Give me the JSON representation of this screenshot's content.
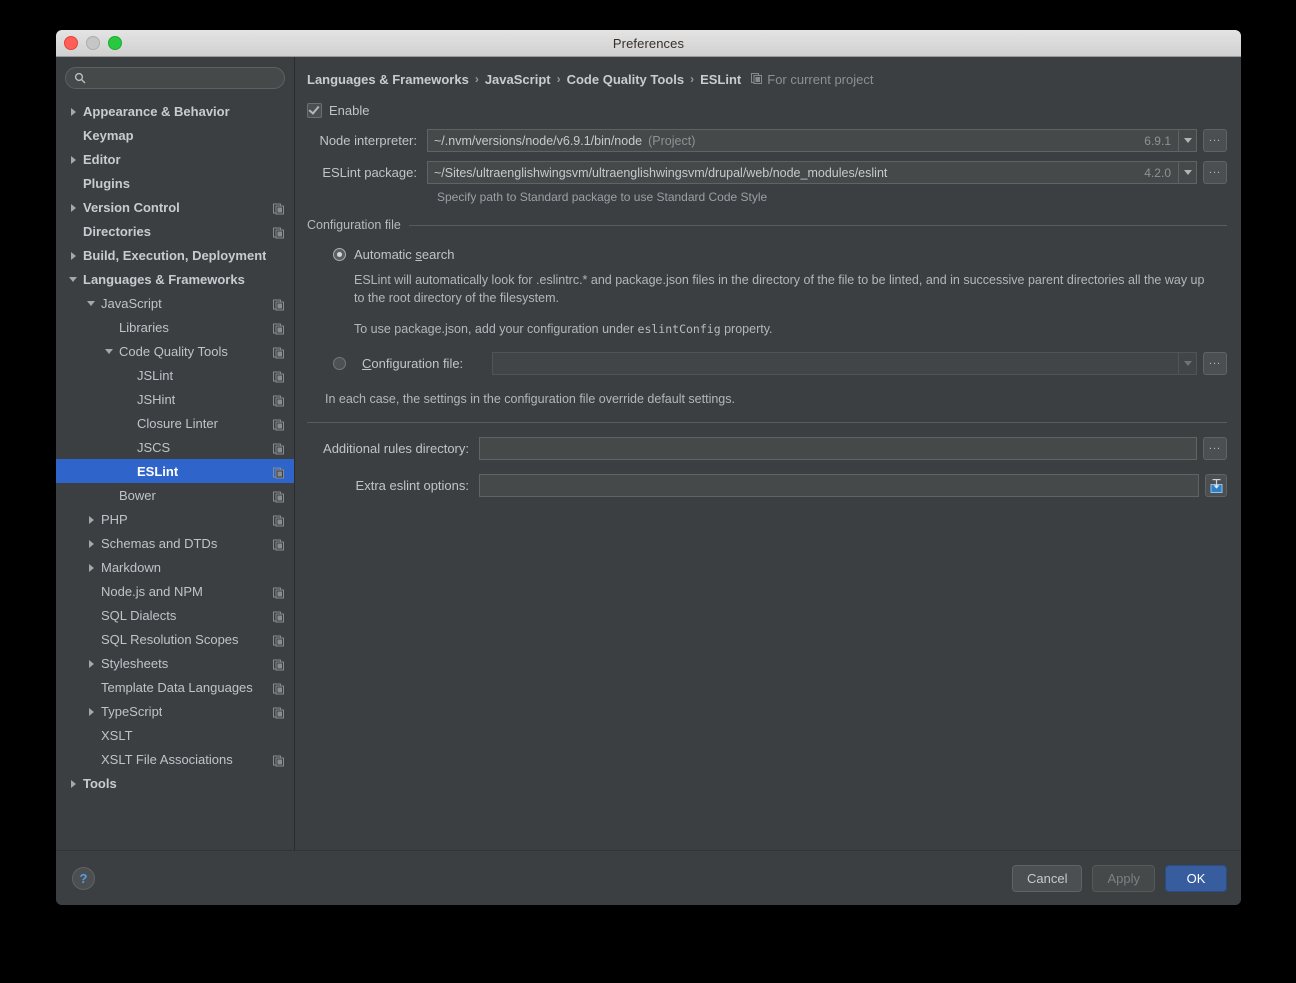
{
  "window": {
    "title": "Preferences",
    "traffic": [
      "close-button",
      "minimize-button",
      "maximize-button"
    ]
  },
  "sidebar": {
    "search": {
      "value": "",
      "placeholder": ""
    },
    "items": [
      {
        "label": "Appearance & Behavior",
        "indent": 0,
        "arrow": "right",
        "bold": true,
        "project_icon": false,
        "selected": false
      },
      {
        "label": "Keymap",
        "indent": 0,
        "arrow": "none",
        "bold": true,
        "project_icon": false,
        "selected": false
      },
      {
        "label": "Editor",
        "indent": 0,
        "arrow": "right",
        "bold": true,
        "project_icon": false,
        "selected": false
      },
      {
        "label": "Plugins",
        "indent": 0,
        "arrow": "none",
        "bold": true,
        "project_icon": false,
        "selected": false
      },
      {
        "label": "Version Control",
        "indent": 0,
        "arrow": "right",
        "bold": true,
        "project_icon": true,
        "selected": false
      },
      {
        "label": "Directories",
        "indent": 0,
        "arrow": "none",
        "bold": true,
        "project_icon": true,
        "selected": false
      },
      {
        "label": "Build, Execution, Deployment",
        "indent": 0,
        "arrow": "right",
        "bold": true,
        "project_icon": false,
        "selected": false
      },
      {
        "label": "Languages & Frameworks",
        "indent": 0,
        "arrow": "down",
        "bold": true,
        "project_icon": false,
        "selected": false
      },
      {
        "label": "JavaScript",
        "indent": 1,
        "arrow": "down",
        "bold": false,
        "project_icon": true,
        "selected": false
      },
      {
        "label": "Libraries",
        "indent": 2,
        "arrow": "none",
        "bold": false,
        "project_icon": true,
        "selected": false
      },
      {
        "label": "Code Quality Tools",
        "indent": 2,
        "arrow": "down",
        "bold": false,
        "project_icon": true,
        "selected": false
      },
      {
        "label": "JSLint",
        "indent": 3,
        "arrow": "none",
        "bold": false,
        "project_icon": true,
        "selected": false
      },
      {
        "label": "JSHint",
        "indent": 3,
        "arrow": "none",
        "bold": false,
        "project_icon": true,
        "selected": false
      },
      {
        "label": "Closure Linter",
        "indent": 3,
        "arrow": "none",
        "bold": false,
        "project_icon": true,
        "selected": false
      },
      {
        "label": "JSCS",
        "indent": 3,
        "arrow": "none",
        "bold": false,
        "project_icon": true,
        "selected": false
      },
      {
        "label": "ESLint",
        "indent": 3,
        "arrow": "none",
        "bold": false,
        "project_icon": true,
        "selected": true
      },
      {
        "label": "Bower",
        "indent": 2,
        "arrow": "none",
        "bold": false,
        "project_icon": true,
        "selected": false
      },
      {
        "label": "PHP",
        "indent": 1,
        "arrow": "right",
        "bold": false,
        "project_icon": true,
        "selected": false
      },
      {
        "label": "Schemas and DTDs",
        "indent": 1,
        "arrow": "right",
        "bold": false,
        "project_icon": true,
        "selected": false
      },
      {
        "label": "Markdown",
        "indent": 1,
        "arrow": "right",
        "bold": false,
        "project_icon": false,
        "selected": false
      },
      {
        "label": "Node.js and NPM",
        "indent": 1,
        "arrow": "none",
        "bold": false,
        "project_icon": true,
        "selected": false
      },
      {
        "label": "SQL Dialects",
        "indent": 1,
        "arrow": "none",
        "bold": false,
        "project_icon": true,
        "selected": false
      },
      {
        "label": "SQL Resolution Scopes",
        "indent": 1,
        "arrow": "none",
        "bold": false,
        "project_icon": true,
        "selected": false
      },
      {
        "label": "Stylesheets",
        "indent": 1,
        "arrow": "right",
        "bold": false,
        "project_icon": true,
        "selected": false
      },
      {
        "label": "Template Data Languages",
        "indent": 1,
        "arrow": "none",
        "bold": false,
        "project_icon": true,
        "selected": false
      },
      {
        "label": "TypeScript",
        "indent": 1,
        "arrow": "right",
        "bold": false,
        "project_icon": true,
        "selected": false
      },
      {
        "label": "XSLT",
        "indent": 1,
        "arrow": "none",
        "bold": false,
        "project_icon": false,
        "selected": false
      },
      {
        "label": "XSLT File Associations",
        "indent": 1,
        "arrow": "none",
        "bold": false,
        "project_icon": true,
        "selected": false
      },
      {
        "label": "Tools",
        "indent": 0,
        "arrow": "right",
        "bold": true,
        "project_icon": false,
        "selected": false
      }
    ]
  },
  "main": {
    "breadcrumb": [
      "Languages & Frameworks",
      "JavaScript",
      "Code Quality Tools",
      "ESLint"
    ],
    "breadcrumb_separator": "›",
    "scope_label": "For current project",
    "enable": {
      "label": "Enable",
      "checked": true
    },
    "node_interpreter": {
      "label": "Node interpreter:",
      "value": "~/.nvm/versions/node/v6.9.1/bin/node",
      "suffix": "(Project)",
      "version": "6.9.1",
      "browse_label": "..."
    },
    "eslint_package": {
      "label": "ESLint package:",
      "value": "~/Sites/ultraenglishwingsvm/ultraenglishwingsvm/drupal/web/node_modules/eslint",
      "version": "4.2.0",
      "browse_label": "..."
    },
    "package_hint": "Specify path to Standard package to use Standard Code Style",
    "config_group": {
      "title": "Configuration file",
      "automatic": {
        "label_pre": "Automatic ",
        "label_mnemonic": "s",
        "label_post": "earch",
        "selected": true
      },
      "automatic_desc": "ESLint will automatically look for .eslintrc.* and package.json files in the directory of the file to be linted, and in successive parent directories all the way up to the root directory of the filesystem.",
      "package_json_desc_pre": "To use package.json, add your configuration under ",
      "package_json_code": "eslintConfig",
      "package_json_desc_post": " property.",
      "config_file": {
        "label_mnemonic": "C",
        "label_post": "onfiguration file:",
        "selected": false,
        "value": "",
        "browse_label": "..."
      },
      "override_note": "In each case, the settings in the configuration file override default settings."
    },
    "additional_rules": {
      "label": "Additional rules directory:",
      "value": "",
      "browse_label": "..."
    },
    "extra_options": {
      "label": "Extra eslint options:",
      "value": ""
    }
  },
  "footer": {
    "help_label": "?",
    "cancel_label": "Cancel",
    "apply_label": "Apply",
    "ok_label": "OK"
  },
  "colors": {
    "window_bg": "#3c3f41",
    "selection_blue": "#2f65ca",
    "default_button_blue": "#375d9e",
    "accent_icon_blue": "#5b9ddb",
    "text_primary": "#c0c4c8",
    "text_muted": "#8d9297"
  }
}
